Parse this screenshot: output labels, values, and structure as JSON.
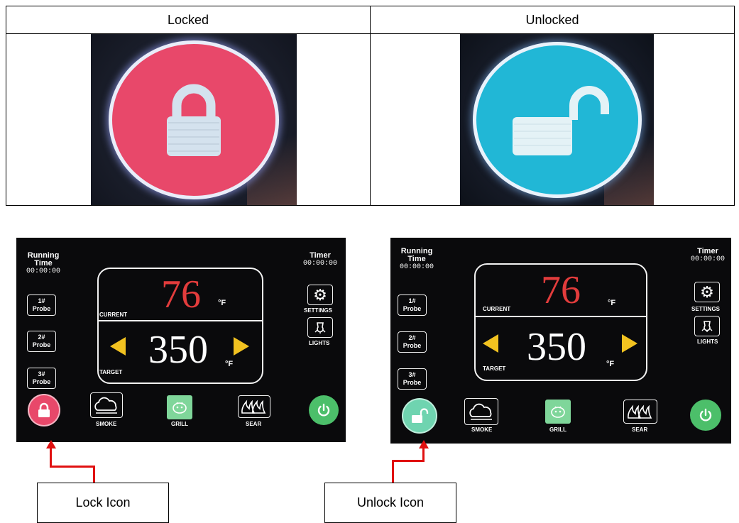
{
  "table": {
    "header_left": "Locked",
    "header_right": "Unlocked"
  },
  "colors": {
    "locked_red": "#e8486a",
    "unlocked_cyan": "#21b7d6",
    "target_arrow": "#f2c220",
    "current_temp": "#e23c3c",
    "power_green": "#4cbf6a",
    "grill_green": "#7fd69a",
    "unlock_mint": "#6fd4b0",
    "callout_red": "#e01010"
  },
  "panels": [
    {
      "running_time_label": "Running Time",
      "running_time": "00:00:00",
      "timer_label": "Timer",
      "timer": "00:00:00",
      "current_label": "CURRENT",
      "current_temp": "76",
      "current_unit": "°F",
      "target_label": "TARGET",
      "target_temp": "350",
      "target_unit": "°F",
      "probes": [
        "1#",
        "2#",
        "3#"
      ],
      "probe_word": "Probe",
      "settings_label": "SETTINGS",
      "lights_label": "LIGHTS",
      "smoke_label": "SMOKE",
      "grill_label": "GRILL",
      "sear_label": "SEAR",
      "lock_state": "locked"
    },
    {
      "running_time_label": "Running Time",
      "running_time": "00:00:00",
      "timer_label": "Timer",
      "timer": "00:00:00",
      "current_label": "CURRENT",
      "current_temp": "76",
      "current_unit": "°F",
      "target_label": "TARGET",
      "target_temp": "350",
      "target_unit": "°F",
      "probes": [
        "1#",
        "2#",
        "3#"
      ],
      "probe_word": "Probe",
      "settings_label": "SETTINGS",
      "lights_label": "LIGHTS",
      "smoke_label": "SMOKE",
      "grill_label": "GRILL",
      "sear_label": "SEAR",
      "lock_state": "unlocked"
    }
  ],
  "callouts": {
    "lock": "Lock Icon",
    "unlock": "Unlock Icon"
  }
}
